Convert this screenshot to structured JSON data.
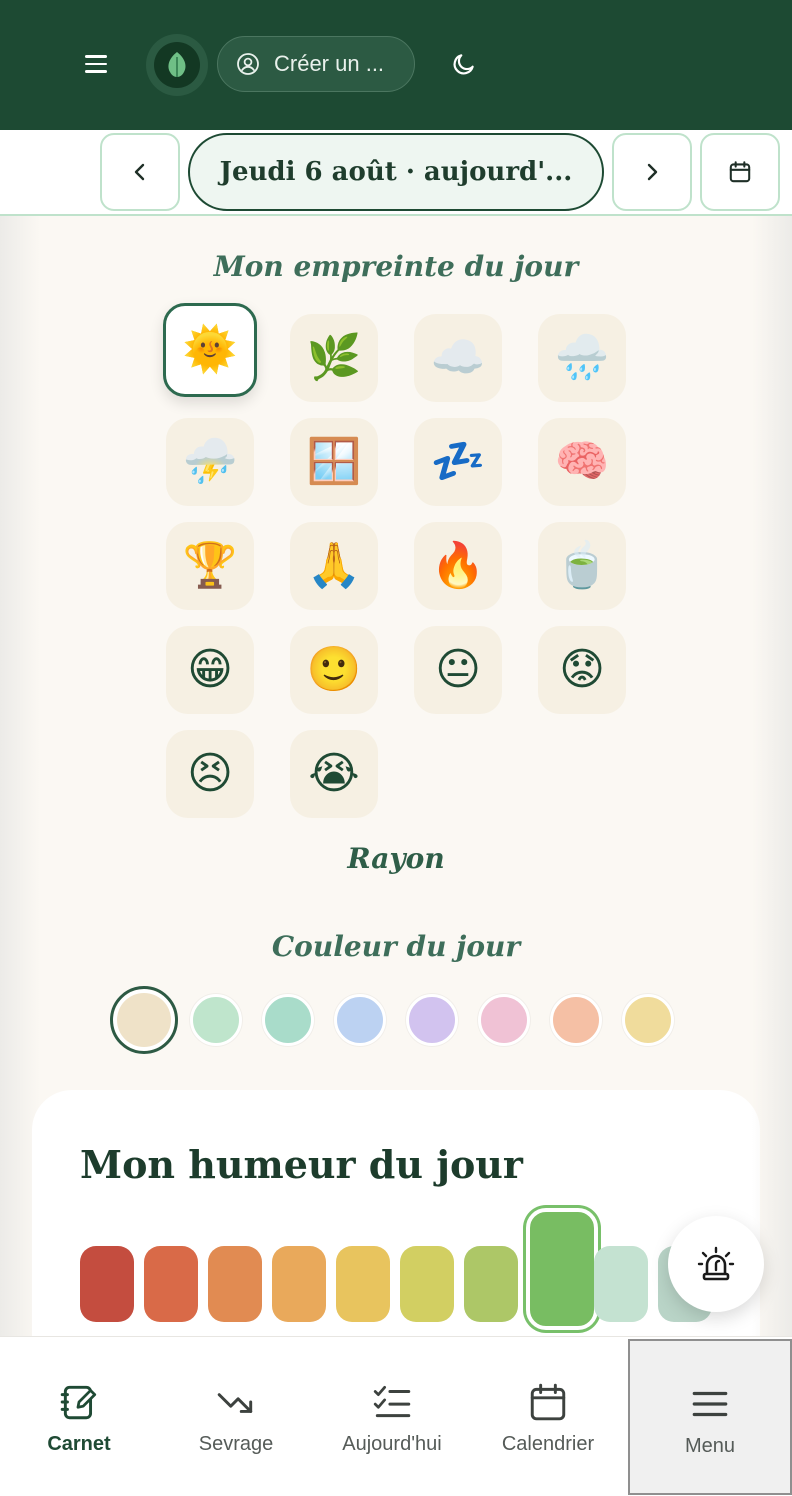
{
  "header": {
    "account_label": "Créer un ...",
    "icons": {
      "menu": "hamburger-icon",
      "logo": "leaf-logo",
      "account": "user-circle-icon",
      "theme": "moon-icon"
    }
  },
  "date_nav": {
    "date_label": "Jeudi 6 août · aujourd'...",
    "prev_icon": "chevron-left-icon",
    "next_icon": "chevron-right-icon",
    "calendar_icon": "calendar-icon"
  },
  "imprint": {
    "title": "Mon empreinte du jour",
    "selected": "sun",
    "items": [
      {
        "id": "sun",
        "glyph": "🌞"
      },
      {
        "id": "herb",
        "glyph": "🌿"
      },
      {
        "id": "cloud",
        "glyph": "☁️"
      },
      {
        "id": "rain",
        "glyph": "🌧️"
      },
      {
        "id": "storm",
        "glyph": "⛈️"
      },
      {
        "id": "window",
        "glyph": "🪟"
      },
      {
        "id": "sleep",
        "glyph": "💤"
      },
      {
        "id": "brain",
        "glyph": "🧠"
      },
      {
        "id": "trophy",
        "glyph": "🏆"
      },
      {
        "id": "pray",
        "glyph": "🙏"
      },
      {
        "id": "fire",
        "glyph": "🔥"
      },
      {
        "id": "tea",
        "glyph": "🍵"
      },
      {
        "id": "grin",
        "glyph": "😁"
      },
      {
        "id": "smile",
        "glyph": "🙂"
      },
      {
        "id": "neutral",
        "glyph": "😐"
      },
      {
        "id": "worried",
        "glyph": "😟"
      },
      {
        "id": "frustrated",
        "glyph": "😣"
      },
      {
        "id": "crying",
        "glyph": "😭"
      }
    ],
    "selected_label": "Rayon"
  },
  "color_of_day": {
    "title": "Couleur du jour",
    "selected_index": 0,
    "colors": [
      "#efe2c8",
      "#bfe5cc",
      "#a9dcca",
      "#bcd2f2",
      "#d2c3ef",
      "#f0c2d5",
      "#f5c0a5",
      "#f0dc9c"
    ]
  },
  "mood": {
    "title": "Mon humeur du jour",
    "selected_index": 7,
    "segments": [
      "#c44d3f",
      "#d96a48",
      "#e18b52",
      "#e9a95b",
      "#e8c45e",
      "#d2cf62",
      "#adc767",
      "#78bd62",
      "#c4e2d1",
      "#b9d4c7"
    ]
  },
  "fab": {
    "icon": "alarm-siren-icon"
  },
  "bottom_nav": {
    "active": "carnet",
    "items": [
      {
        "id": "carnet",
        "label": "Carnet",
        "icon": "notebook-edit-icon"
      },
      {
        "id": "sevrage",
        "label": "Sevrage",
        "icon": "trend-down-icon"
      },
      {
        "id": "aujourdhui",
        "label": "Aujourd'hui",
        "icon": "checklist-icon"
      },
      {
        "id": "calendrier",
        "label": "Calendrier",
        "icon": "calendar-icon"
      },
      {
        "id": "menu",
        "label": "Menu",
        "icon": "menu-icon"
      }
    ]
  }
}
